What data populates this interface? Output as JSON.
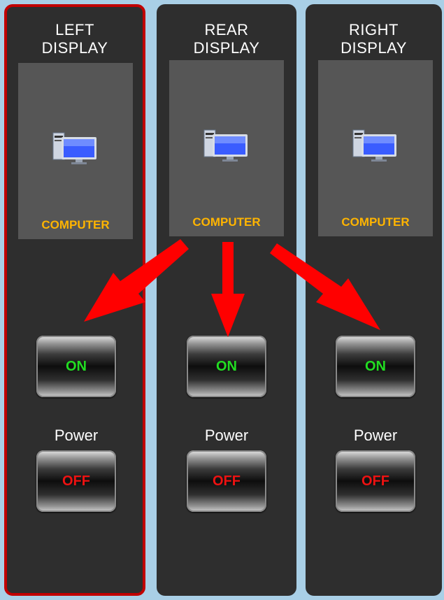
{
  "panels": [
    {
      "title": "LEFT\nDISPLAY",
      "source_label": "COMPUTER",
      "on_label": "ON",
      "power_label": "Power",
      "off_label": "OFF",
      "selected": true
    },
    {
      "title": "REAR\nDISPLAY",
      "source_label": "COMPUTER",
      "on_label": "ON",
      "power_label": "Power",
      "off_label": "OFF",
      "selected": false
    },
    {
      "title": "RIGHT\nDISPLAY",
      "source_label": "COMPUTER",
      "on_label": "ON",
      "power_label": "Power",
      "off_label": "OFF",
      "selected": false
    }
  ],
  "icons": {
    "source": "computer-monitor-icon",
    "annotation": "arrow"
  },
  "colors": {
    "background": "#a9cfe6",
    "panel": "#2e2e2e",
    "tile": "#565656",
    "selected_border": "#c00000",
    "source_label": "#ffb400",
    "on_text": "#22dd22",
    "off_text": "#ee1111",
    "arrow": "#ff0000"
  }
}
